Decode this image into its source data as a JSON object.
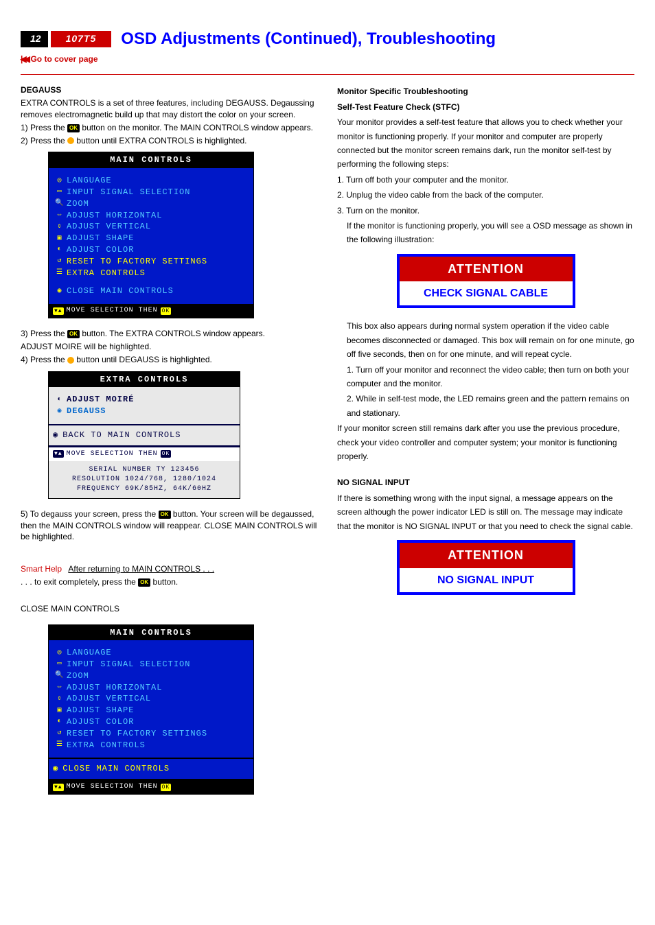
{
  "header": {
    "page_num": "12",
    "model": "107T5",
    "title": "OSD  Adjustments (Continued), Troubleshooting",
    "coverlink": "Go to cover page"
  },
  "left": {
    "degauss_h": "DEGAUSS",
    "p1": "EXTRA CONTROLS is a set of three features, including DEGAUSS. Degaussing removes electromagnetic build up that may distort the color on your screen.",
    "s1a": "1) Press the",
    "s1b": "button on the monitor. The MAIN CONTROLS window appears.",
    "s2a": "2) Press the",
    "s2b": "button until EXTRA CONTROLS is highlighted.",
    "s3a": "3) Press the",
    "s3b": "button. The EXTRA CONTROLS window appears.",
    "s3c": " ADJUST MOIRE  will be highlighted.",
    "s4a": "4) Press the",
    "s4b": "button until DEGAUSS is highlighted.",
    "s5a": "5) To degauss your screen, press the",
    "s5b": "button. Your screen will be degaussed, then the MAIN CONTROLS window will reappear. CLOSE MAIN CONTROLS will be highlighted.",
    "smart_label": "Smart Help",
    "smart_t1": "After returning to MAIN CONTROLS . . .",
    "smart_t2a": ". . . to exit completely, press the",
    "smart_t2b": "button.",
    "close_h": "CLOSE MAIN CONTROLS"
  },
  "osd1": {
    "title": "MAIN CONTROLS",
    "items": [
      "LANGUAGE",
      "INPUT SIGNAL SELECTION",
      "ZOOM",
      "ADJUST HORIZONTAL",
      "ADJUST VERTICAL",
      "ADJUST SHAPE",
      "ADJUST COLOR",
      "RESET TO FACTORY SETTINGS",
      "EXTRA CONTROLS"
    ],
    "close": "CLOSE MAIN CONTROLS",
    "footer": "MOVE SELECTION THEN"
  },
  "osd2": {
    "title": "EXTRA CONTROLS",
    "items": [
      "ADJUST MOIRÉ",
      "DEGAUSS"
    ],
    "back": "BACK TO MAIN CONTROLS",
    "footer": "MOVE SELECTION THEN",
    "info1": "SERIAL NUMBER TY 123456",
    "info2": "RESOLUTION 1024/768, 1280/1024",
    "info3": "FREQUENCY 69K/85HZ, 64K/60HZ"
  },
  "osd3": {
    "title": "MAIN CONTROLS",
    "items": [
      "LANGUAGE",
      "INPUT SIGNAL SELECTION",
      "ZOOM",
      "ADJUST HORIZONTAL",
      "ADJUST VERTICAL",
      "ADJUST SHAPE",
      "ADJUST COLOR",
      "RESET TO FACTORY SETTINGS",
      "EXTRA CONTROLS"
    ],
    "close": "CLOSE MAIN CONTROLS",
    "footer": "MOVE SELECTION THEN"
  },
  "right": {
    "h1": "Monitor Specific Troubleshooting",
    "h2": "Self-Test Feature Check (STFC)",
    "p1": "Your monitor provides a self-test feature that allows you to check whether your monitor is functioning properly. If your monitor and computer are properly connected but the monitor screen remains dark, run the monitor self-test by performing the following steps:",
    "l1": "1. Turn off both your computer and the monitor.",
    "l2": "2. Unplug the video cable from the back of the computer.",
    "l3": "3. Turn on the monitor.",
    "l3b": "If the monitor is functioning properly, you will see a OSD message as shown in the following illustration:",
    "att1_h": "ATTENTION",
    "att1_m": "CHECK SIGNAL CABLE",
    "p2": "This box also appears during normal system operation if the video cable becomes disconnected or damaged. This box will remain on for one minute, go off five seconds, then on for one minute, and will repeat cycle.",
    "l4": "1. Turn off your monitor and reconnect the video cable; then turn on both your computer and the monitor.",
    "l5": "2. While in self-test mode, the LED remains green and the pattern remains on and stationary.",
    "p3": "If your monitor screen still remains dark after you use the previous procedure, check your video controller and computer system; your monitor is functioning properly.",
    "h3": "NO SIGNAL INPUT",
    "p4": "If there is something wrong with the input signal, a message appears on the screen although the power indicator LED is still on. The message may indicate that the monitor is NO SIGNAL INPUT or that you need to check the signal cable.",
    "att2_h": "ATTENTION",
    "att2_m": "NO SIGNAL INPUT"
  }
}
